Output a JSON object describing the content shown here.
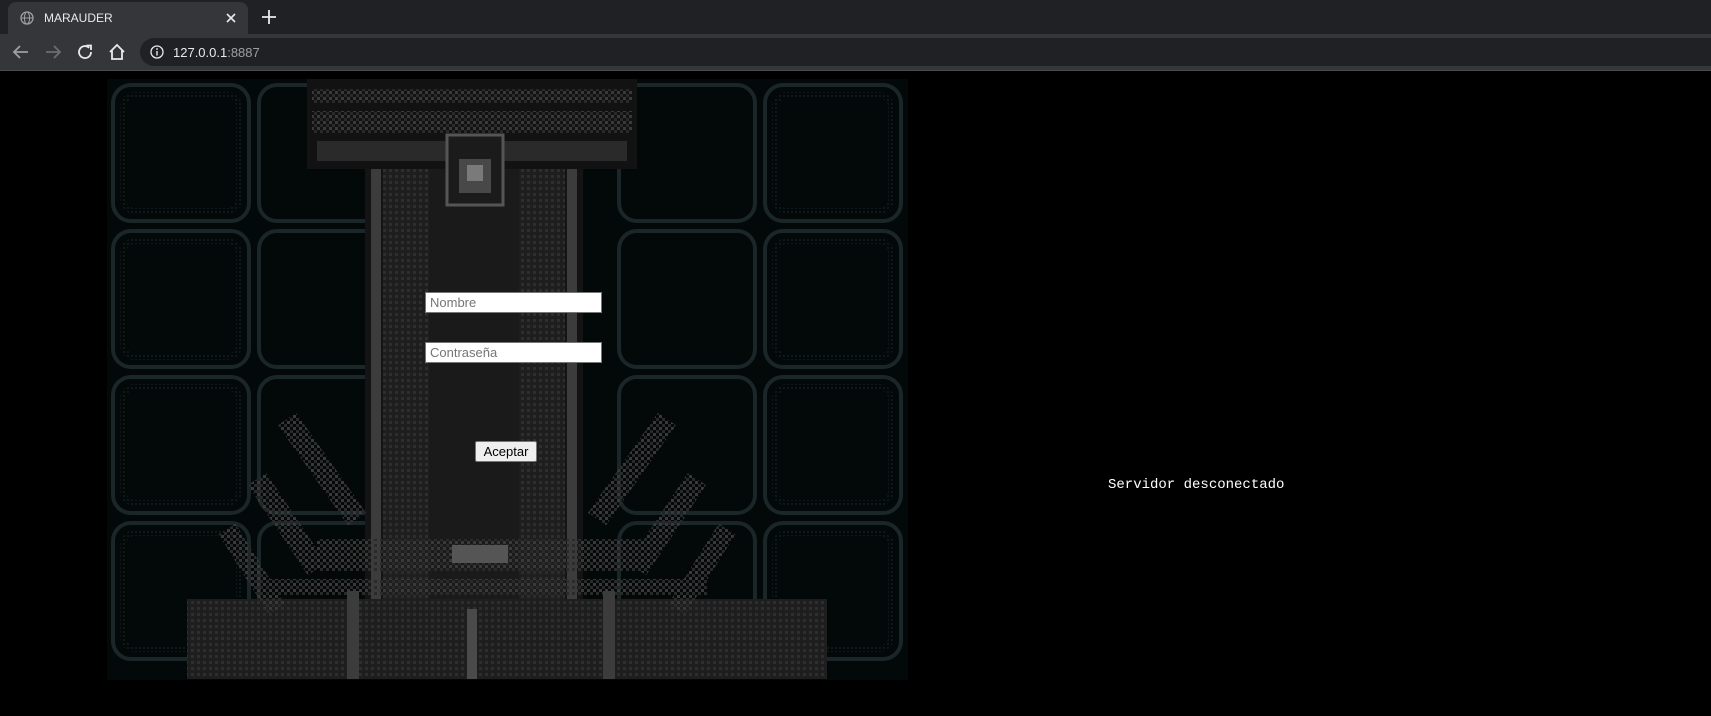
{
  "browser": {
    "tab": {
      "title": "MARAUDER",
      "favicon": "globe-icon"
    },
    "address": {
      "host": "127.0.0.1",
      "port": ":8887"
    },
    "icons": [
      "back-arrow-icon",
      "forward-arrow-icon",
      "reload-icon",
      "home-icon",
      "info-icon",
      "close-icon",
      "plus-icon"
    ]
  },
  "login": {
    "name_placeholder": "Nombre",
    "password_placeholder": "Contraseña",
    "submit_label": "Aceptar"
  },
  "status": {
    "text": "Servidor desconectado"
  },
  "colors": {
    "chrome_dark": "#202124",
    "chrome_mid": "#35363a",
    "page_background": "#000000",
    "panel_background": "#040a0b"
  }
}
